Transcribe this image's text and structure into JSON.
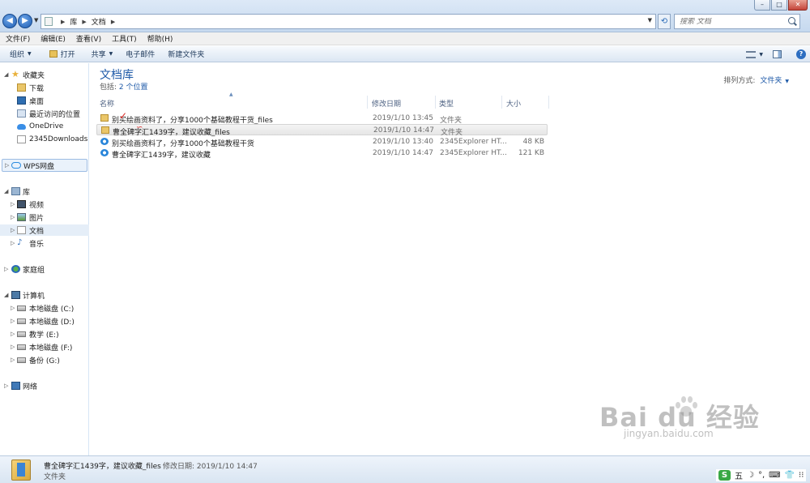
{
  "address": {
    "crumbs": [
      "库",
      "文档"
    ],
    "search_placeholder": "搜索 文档"
  },
  "window_controls": {
    "minimize": "–",
    "maximize": "□",
    "close": "✕"
  },
  "menu": [
    "文件(F)",
    "编辑(E)",
    "查看(V)",
    "工具(T)",
    "帮助(H)"
  ],
  "toolbar": {
    "organize": "组织",
    "open": "打开",
    "share": "共享",
    "email": "电子邮件",
    "new_folder": "新建文件夹",
    "help": "?"
  },
  "nav": {
    "favorites": "收藏夹",
    "downloads": "下载",
    "desktop": "桌面",
    "recent": "最近访问的位置",
    "onedrive": "OneDrive",
    "downloads2345": "2345Downloads",
    "wps": "WPS网盘",
    "libraries": "库",
    "videos": "视频",
    "pictures": "图片",
    "documents": "文档",
    "music": "音乐",
    "homegroup": "家庭组",
    "computer": "计算机",
    "drive_c": "本地磁盘 (C:)",
    "drive_d": "本地磁盘 (D:)",
    "drive_e": "教学 (E:)",
    "drive_f": "本地磁盘 (F:)",
    "drive_g": "备份 (G:)",
    "network": "网络"
  },
  "library": {
    "title": "文档库",
    "includes_label": "包括:",
    "includes_link": "2 个位置",
    "arrange_label": "排列方式:",
    "arrange_value": "文件夹"
  },
  "columns": {
    "name": "名称",
    "date": "修改日期",
    "type": "类型",
    "size": "大小"
  },
  "files": [
    {
      "name": "别买绘画资料了，分享1000个基础教程干货_files",
      "date": "2019/1/10 13:45",
      "type": "文件夹",
      "size": "",
      "icon": "folder-icon"
    },
    {
      "name": "曹全碑字汇1439字，建议收藏_files",
      "date": "2019/1/10 14:47",
      "type": "文件夹",
      "size": "",
      "icon": "folder-icon"
    },
    {
      "name": "别买绘画资料了，分享1000个基础教程干货",
      "date": "2019/1/10 13:40",
      "type": "2345Explorer HT...",
      "size": "48 KB",
      "icon": "browser-icon"
    },
    {
      "name": "曹全碑字汇1439字，建议收藏",
      "date": "2019/1/10 14:47",
      "type": "2345Explorer HT...",
      "size": "121 KB",
      "icon": "browser-icon"
    }
  ],
  "details": {
    "name": "曹全碑字汇1439字，建议收藏_files",
    "meta": "修改日期: 2019/1/10 14:47",
    "type": "文件夹"
  },
  "watermark": {
    "brand": "Bai du 经验",
    "url": "jingyan.baidu.com"
  },
  "ime": {
    "logo": "S",
    "mode": "五",
    "moon": "☽",
    "punct": "°,",
    "keyboard": "⌨",
    "skin": "👕",
    "tools": "⁝⁝"
  }
}
